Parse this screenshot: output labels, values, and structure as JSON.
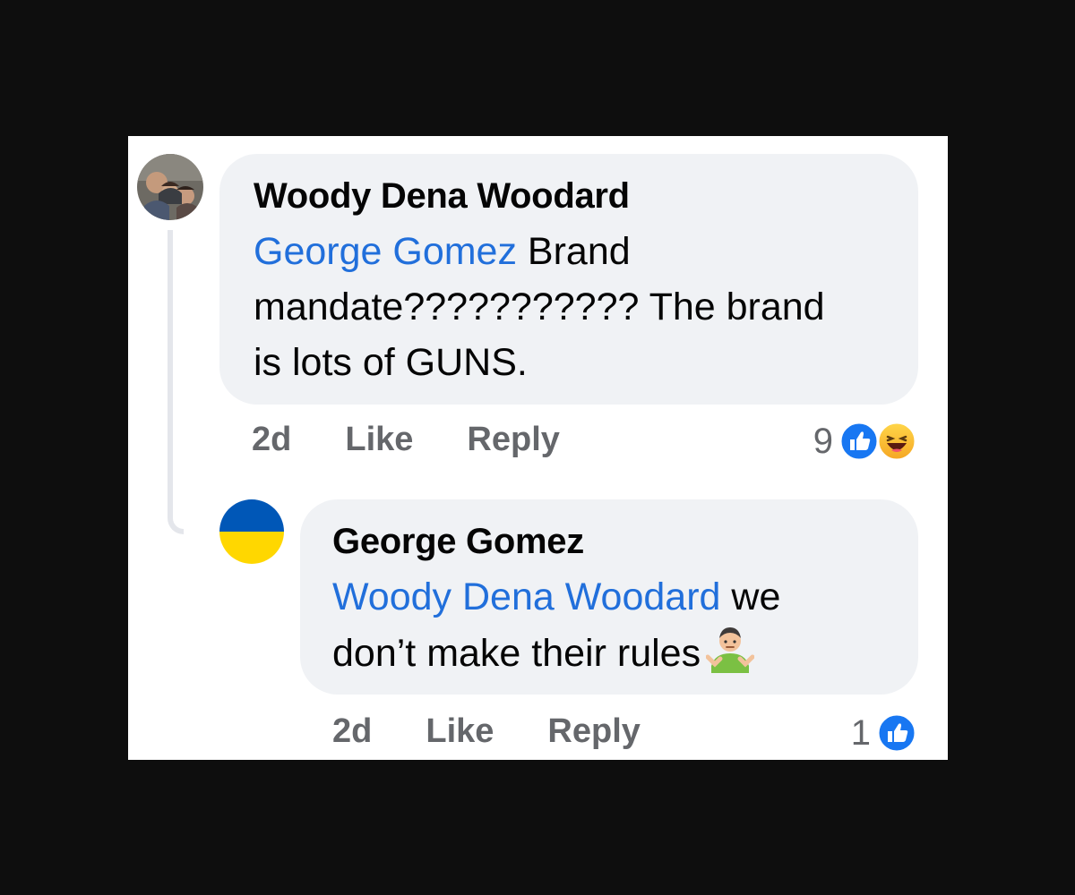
{
  "comments": [
    {
      "author": "Woody Dena Woodard",
      "mention": "George Gomez",
      "text_line1": " Brand",
      "text_line2": "mandate??????????? The brand",
      "text_line3": "is lots of GUNS.",
      "time": "2d",
      "like_label": "Like",
      "reply_label": "Reply",
      "reaction_count": "9",
      "reactions": [
        "like-icon",
        "haha-icon"
      ]
    },
    {
      "author": "George Gomez",
      "mention": "Woody Dena Woodard",
      "text_line1": "  we",
      "text_line2": "don’t make their rules",
      "emoji": "person-shrugging-icon",
      "time": "2d",
      "like_label": "Like",
      "reply_label": "Reply",
      "reaction_count": "1",
      "reactions": [
        "like-icon"
      ]
    }
  ],
  "colors": {
    "mention": "#216fdb",
    "bubble": "#f0f2f5",
    "meta": "#65676b",
    "like_blue": "#1877f2",
    "flag_blue": "#0057b7",
    "flag_yellow": "#ffd700"
  }
}
